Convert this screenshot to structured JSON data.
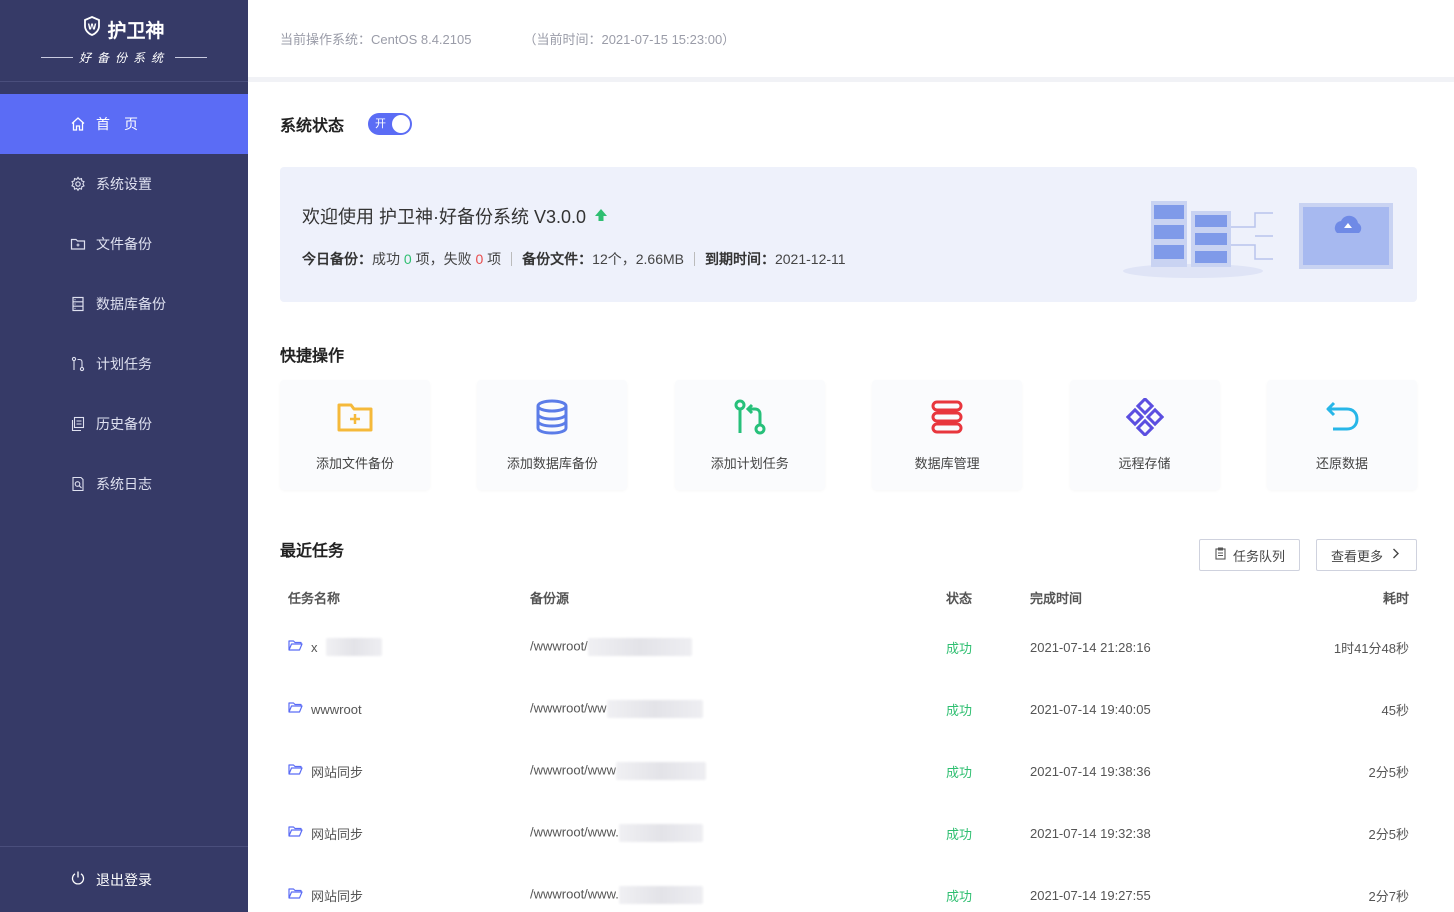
{
  "brand": {
    "name": "护卫神",
    "subtitle": "好备份系统"
  },
  "sidebar": {
    "items": [
      {
        "label": "首　页",
        "icon": "home-icon",
        "active": true
      },
      {
        "label": "系统设置",
        "icon": "gear-icon"
      },
      {
        "label": "文件备份",
        "icon": "folder-icon"
      },
      {
        "label": "数据库备份",
        "icon": "database-icon"
      },
      {
        "label": "计划任务",
        "icon": "branch-icon"
      },
      {
        "label": "历史备份",
        "icon": "history-icon"
      },
      {
        "label": "系统日志",
        "icon": "log-icon"
      }
    ],
    "logout": "退出登录"
  },
  "header": {
    "os": "当前操作系统：CentOS 8.4.2105",
    "time": "（当前时间：2021-07-15 15:23:00）"
  },
  "status": {
    "title": "系统状态",
    "toggle_label": "开",
    "on": true
  },
  "welcome": {
    "title": "欢迎使用 护卫神·好备份系统 V3.0.0",
    "today_label": "今日备份：",
    "success_prefix": "成功",
    "success_count": "0",
    "success_unit": "项，失败",
    "fail_count": "0",
    "fail_unit": "项",
    "files_label": "备份文件：",
    "files_value": "12个，2.66MB",
    "expire_label": "到期时间：",
    "expire_value": "2021-12-11"
  },
  "quick": {
    "title": "快捷操作",
    "items": [
      {
        "label": "添加文件备份",
        "icon": "folder-add-icon",
        "color": "#f5b93a"
      },
      {
        "label": "添加数据库备份",
        "icon": "database-icon",
        "color": "#5b7ce8"
      },
      {
        "label": "添加计划任务",
        "icon": "branch-icon",
        "color": "#27c07a"
      },
      {
        "label": "数据库管理",
        "icon": "server-icon",
        "color": "#e8363d"
      },
      {
        "label": "远程存储",
        "icon": "nodes-icon",
        "color": "#5b4ee0"
      },
      {
        "label": "还原数据",
        "icon": "undo-icon",
        "color": "#27b6e8"
      }
    ]
  },
  "recent": {
    "title": "最近任务",
    "queue_button": "任务队列",
    "more_button": "查看更多",
    "columns": [
      "任务名称",
      "备份源",
      "状态",
      "完成时间",
      "耗时"
    ],
    "rows": [
      {
        "name": "x",
        "source": "/wwwroot/",
        "status": "成功",
        "time": "2021-07-14 21:28:16",
        "duration": "1时41分48秒"
      },
      {
        "name": "wwwroot",
        "source": "/wwwroot/ww",
        "status": "成功",
        "time": "2021-07-14 19:40:05",
        "duration": "45秒"
      },
      {
        "name": "网站同步",
        "source": "/wwwroot/www",
        "status": "成功",
        "time": "2021-07-14 19:38:36",
        "duration": "2分5秒"
      },
      {
        "name": "网站同步",
        "source": "/wwwroot/www.",
        "status": "成功",
        "time": "2021-07-14 19:32:38",
        "duration": "2分5秒"
      },
      {
        "name": "网站同步",
        "source": "/wwwroot/www.",
        "status": "成功",
        "time": "2021-07-14 19:27:55",
        "duration": "2分7秒"
      }
    ]
  }
}
